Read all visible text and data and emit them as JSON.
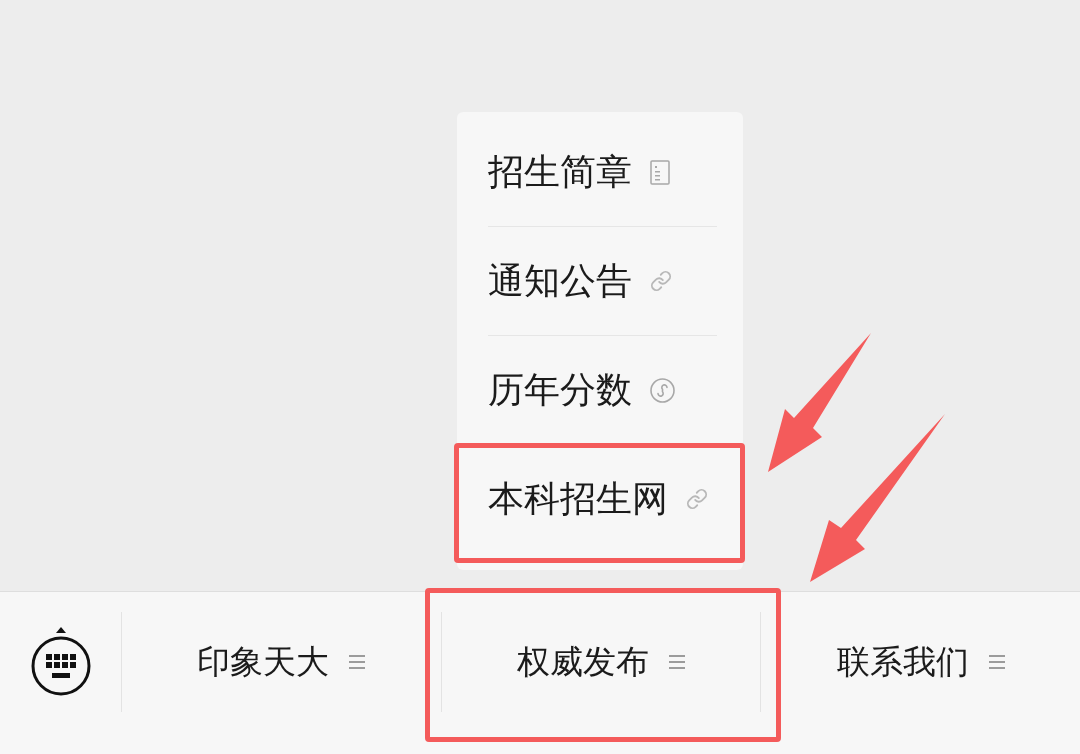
{
  "menu_bar": {
    "tabs": [
      {
        "label": "印象天大",
        "expanded": false,
        "highlighted": false
      },
      {
        "label": "权威发布",
        "expanded": true,
        "highlighted": true,
        "submenu": [
          {
            "label": "招生简章",
            "kind": "article",
            "highlighted": false
          },
          {
            "label": "通知公告",
            "kind": "link",
            "highlighted": false
          },
          {
            "label": "历年分数",
            "kind": "miniprogram",
            "highlighted": false
          },
          {
            "label": "本科招生网",
            "kind": "link",
            "highlighted": true
          }
        ]
      },
      {
        "label": "联系我们",
        "expanded": false,
        "highlighted": false
      }
    ]
  }
}
